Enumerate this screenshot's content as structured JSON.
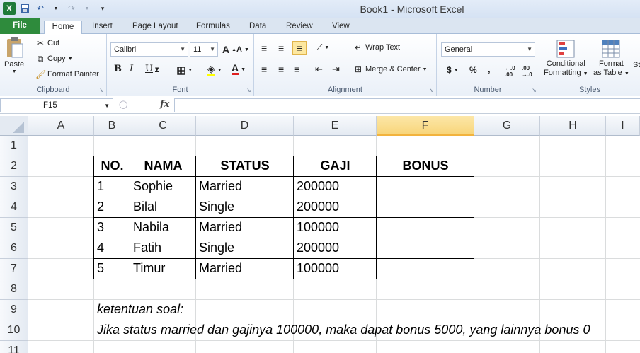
{
  "window": {
    "title": "Book1  -  Microsoft Excel"
  },
  "tabs": [
    "File",
    "Home",
    "Insert",
    "Page Layout",
    "Formulas",
    "Data",
    "Review",
    "View"
  ],
  "clipboard": {
    "paste": "Paste",
    "cut": "Cut",
    "copy": "Copy",
    "format_painter": "Format Painter",
    "label": "Clipboard"
  },
  "font": {
    "name": "Calibri",
    "size": "11",
    "label": "Font"
  },
  "alignment": {
    "wrap_text": "Wrap Text",
    "merge_center": "Merge & Center",
    "label": "Alignment"
  },
  "number": {
    "format": "General",
    "label": "Number"
  },
  "styles": {
    "conditional": "Conditional",
    "formatting": "Formatting",
    "format": "Format",
    "as_table": "as Table",
    "cell_styles_cut": "Sty",
    "label": "Styles"
  },
  "formula_bar": {
    "name_box": "F15",
    "fx": "fx",
    "content": ""
  },
  "columns": [
    "A",
    "B",
    "C",
    "D",
    "E",
    "F",
    "G",
    "H",
    "I"
  ],
  "rows": [
    "1",
    "2",
    "3",
    "4",
    "5",
    "6",
    "7",
    "8",
    "9",
    "10",
    "11"
  ],
  "table": {
    "headers": [
      "NO.",
      "NAMA",
      "STATUS",
      "GAJI",
      "BONUS"
    ],
    "rows": [
      [
        "1",
        "Sophie",
        "Married",
        "200000",
        ""
      ],
      [
        "2",
        "Bilal",
        "Single",
        "200000",
        ""
      ],
      [
        "3",
        "Nabila",
        "Married",
        "100000",
        ""
      ],
      [
        "4",
        "Fatih",
        "Single",
        "200000",
        ""
      ],
      [
        "5",
        "Timur",
        "Married",
        "100000",
        ""
      ]
    ]
  },
  "notes": {
    "title": "ketentuan soal:",
    "text": "Jika status married dan gajinya 100000, maka dapat bonus 5000, yang lainnya bonus 0"
  },
  "colors": {
    "file_tab": "#2e8b3c",
    "selected_col": "#f8d57a"
  }
}
